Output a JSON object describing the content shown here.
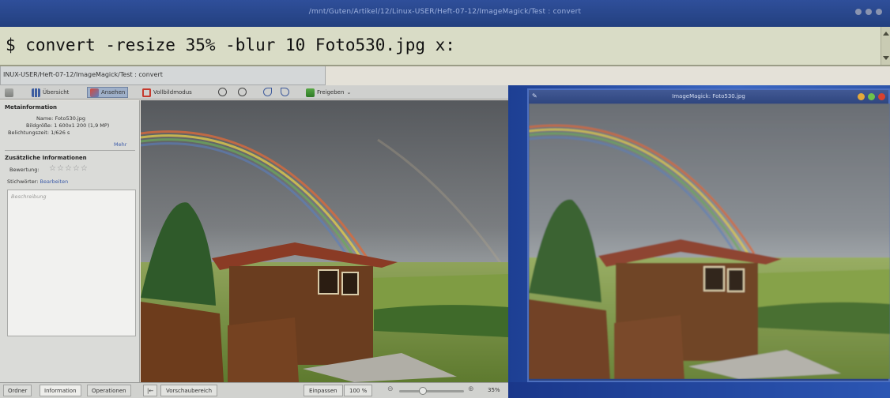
{
  "terminal": {
    "title": "/mnt/Guten/Artikel/12/Linux-USER/Heft-07-12/ImageMagick/Test : convert",
    "command": "$ convert -resize 35% -blur 10 Foto530.jpg x:"
  },
  "gwenview": {
    "window_title": "INUX-USER/Heft-07-12/ImageMagick/Test : convert",
    "toolbar": {
      "overview": "Übersicht",
      "view": "Ansehen",
      "fullscreen": "Vollbildmodus",
      "share": "Freigeben"
    },
    "meta": {
      "header": "Metainformation",
      "name_label": "Name:",
      "name_value": "Foto530.jpg",
      "size_label": "Bildgröße:",
      "size_value": "1 600x1 200 (1,9 MP)",
      "exposure_label": "Belichtungszeit:",
      "exposure_value": "1/626 s",
      "more": "Mehr"
    },
    "extra": {
      "header": "Zusätzliche Informationen",
      "rating_label": "Bewertung:",
      "rating_value": 0,
      "keywords_label": "Stichwörter:",
      "keywords_link": "Bearbeiten",
      "description_placeholder": "Beschreibung"
    },
    "statusbar": {
      "tabs": [
        "Ordner",
        "Information",
        "Operationen"
      ],
      "selected_tab": "Information",
      "preview_label": "Vorschaubereich",
      "fit_label": "Einpassen",
      "zoom_100": "100 %",
      "zoom_value": "35%",
      "zoom_fraction": 0.35
    }
  },
  "imagemagick": {
    "title": "ImageMagick: Foto530.jpg"
  },
  "colors": {
    "terminal_bg": "#d9dcc6",
    "desktop_blue": "#2d55aa",
    "link": "#3b5aa8"
  }
}
